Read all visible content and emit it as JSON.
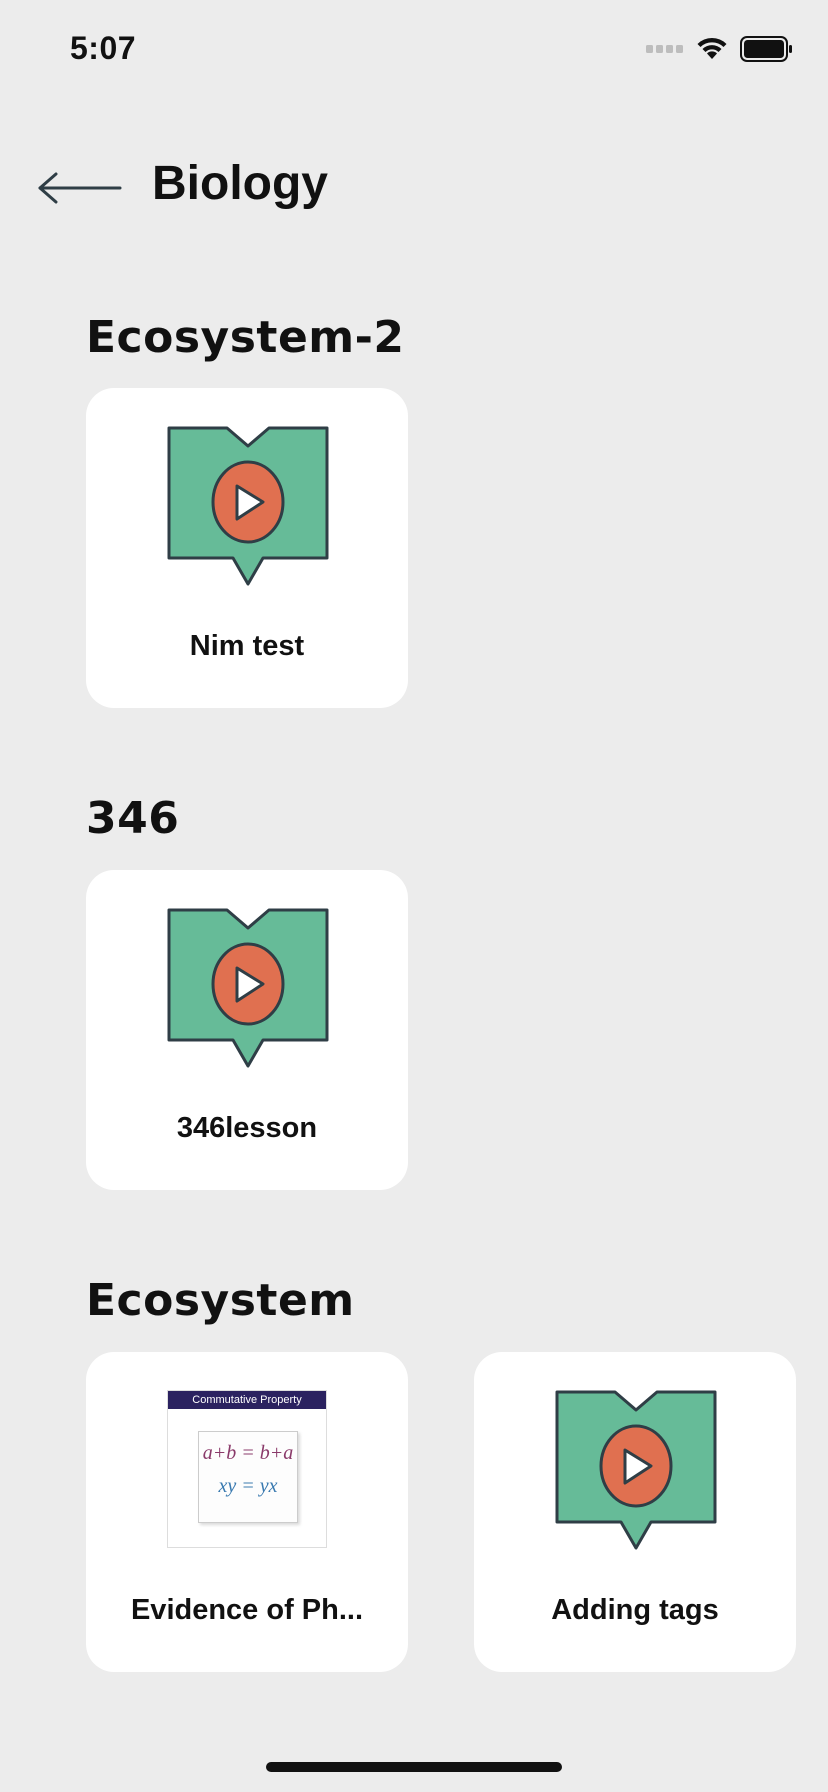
{
  "status_bar": {
    "time": "5:07",
    "icons": [
      "cellular-signal-icon",
      "wifi-icon",
      "battery-icon"
    ]
  },
  "header": {
    "back_icon": "arrow-left-icon",
    "title": "Biology"
  },
  "colors": {
    "background": "#ececec",
    "card": "#ffffff",
    "book_green": "#66bb98",
    "play_orange": "#e07050",
    "outline": "#2f3e46"
  },
  "sections": [
    {
      "title": "Ecosystem-2",
      "cards": [
        {
          "label": "Nim test",
          "thumbnail": "video-lesson-icon"
        }
      ]
    },
    {
      "title": "346",
      "cards": [
        {
          "label": "346lesson",
          "thumbnail": "video-lesson-icon"
        }
      ]
    },
    {
      "title": "Ecosystem",
      "cards": [
        {
          "label": "Evidence of Ph...",
          "thumbnail": "image-thumbnail",
          "thumbnail_text": {
            "banner": "Commutative Property",
            "line1": "a+b = b+a",
            "line2": "xy = yx"
          }
        },
        {
          "label": "Adding tags",
          "thumbnail": "video-lesson-icon"
        }
      ]
    }
  ]
}
